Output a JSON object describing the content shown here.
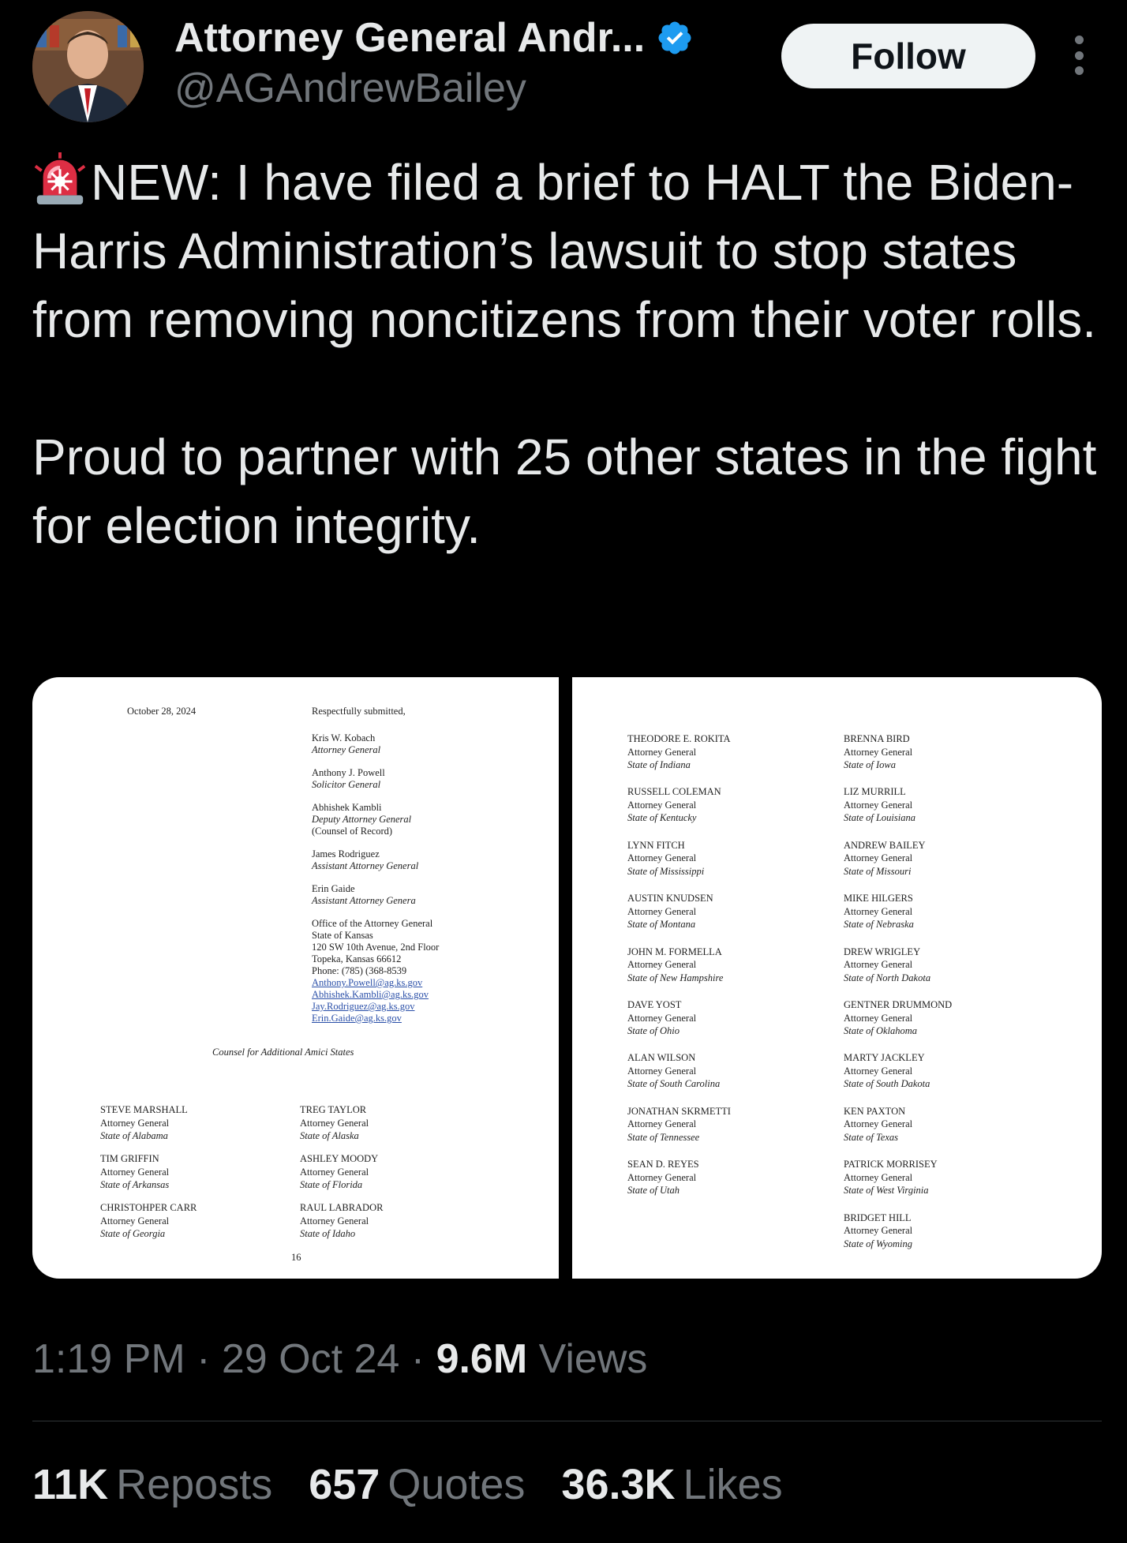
{
  "header": {
    "display_name": "Attorney General Andr...",
    "handle": "@AGAndrewBailey",
    "follow_label": "Follow"
  },
  "tweet": {
    "line1": "NEW: I have filed a brief to HALT the Biden-Harris Administration’s lawsuit to stop states from removing noncitizens from their voter rolls.",
    "line2": "Proud to partner with 25 other states in the fight for election integrity."
  },
  "doc_page1": {
    "date": "October 28, 2024",
    "submitted": "Respectfully submitted,",
    "counsel": [
      {
        "name": "Kris W. Kobach",
        "title": "Attorney General",
        "extra": ""
      },
      {
        "name": "Anthony J. Powell",
        "title": "Solicitor General",
        "extra": ""
      },
      {
        "name": "Abhishek Kambli",
        "title": "Deputy Attorney General",
        "extra": "(Counsel of Record)"
      },
      {
        "name": "James Rodriguez",
        "title": "Assistant Attorney General",
        "extra": ""
      },
      {
        "name": "Erin Gaide",
        "title": "Assistant Attorney Genera",
        "extra": ""
      }
    ],
    "office": [
      "Office of the Attorney General",
      "State of Kansas",
      "120 SW 10th Avenue, 2nd Floor",
      "Topeka, Kansas 66612",
      "Phone: (785) (368-8539"
    ],
    "emails": [
      "Anthony.Powell@ag.ks.gov",
      "Abhishek.Kambli@ag.ks.gov",
      "Jay.Rodriguez@ag.ks.gov",
      "Erin.Gaide@ag.ks.gov"
    ],
    "counsel_for": "Counsel for Additional Amici States",
    "states": [
      {
        "name": "STEVE MARSHALL",
        "role": "Attorney General",
        "state": "State of Alabama"
      },
      {
        "name": "TREG TAYLOR",
        "role": "Attorney General",
        "state": "State of Alaska"
      },
      {
        "name": "TIM GRIFFIN",
        "role": "Attorney General",
        "state": "State of Arkansas"
      },
      {
        "name": "ASHLEY MOODY",
        "role": "Attorney General",
        "state": "State of Florida"
      },
      {
        "name": "CHRISTOHPER CARR",
        "role": "Attorney General",
        "state": "State of Georgia"
      },
      {
        "name": "RAUL LABRADOR",
        "role": "Attorney General",
        "state": "State of Idaho"
      }
    ],
    "page_number": "16"
  },
  "doc_page2": {
    "left": [
      {
        "name": "THEODORE E. ROKITA",
        "role": "Attorney General",
        "state": "State of Indiana"
      },
      {
        "name": "RUSSELL COLEMAN",
        "role": "Attorney General",
        "state": "State of Kentucky"
      },
      {
        "name": "LYNN FITCH",
        "role": "Attorney General",
        "state": "State of Mississippi"
      },
      {
        "name": "AUSTIN KNUDSEN",
        "role": "Attorney General",
        "state": "State of Montana"
      },
      {
        "name": "JOHN M. FORMELLA",
        "role": "Attorney General",
        "state": "State of New Hampshire"
      },
      {
        "name": "DAVE YOST",
        "role": "Attorney General",
        "state": "State of Ohio"
      },
      {
        "name": "ALAN WILSON",
        "role": "Attorney General",
        "state": "State of South Carolina"
      },
      {
        "name": "JONATHAN SKRMETTI",
        "role": "Attorney General",
        "state": "State of Tennessee"
      },
      {
        "name": "SEAN D. REYES",
        "role": "Attorney General",
        "state": "State of Utah"
      }
    ],
    "right": [
      {
        "name": "BRENNA BIRD",
        "role": "Attorney General",
        "state": "State of Iowa"
      },
      {
        "name": "LIZ MURRILL",
        "role": "Attorney General",
        "state": "State of Louisiana"
      },
      {
        "name": "ANDREW BAILEY",
        "role": "Attorney General",
        "state": "State of Missouri"
      },
      {
        "name": "MIKE HILGERS",
        "role": "Attorney General",
        "state": "State of Nebraska"
      },
      {
        "name": "DREW WRIGLEY",
        "role": "Attorney General",
        "state": "State of North Dakota"
      },
      {
        "name": "GENTNER DRUMMOND",
        "role": "Attorney General",
        "state": "State of Oklahoma"
      },
      {
        "name": "MARTY JACKLEY",
        "role": "Attorney General",
        "state": "State of South Dakota"
      },
      {
        "name": "KEN PAXTON",
        "role": "Attorney General",
        "state": "State of Texas"
      },
      {
        "name": "PATRICK MORRISEY",
        "role": "Attorney General",
        "state": "State of West Virginia"
      },
      {
        "name": "BRIDGET HILL",
        "role": "Attorney General",
        "state": "State of Wyoming"
      }
    ]
  },
  "meta": {
    "time": "1:19 PM",
    "date": "29 Oct 24",
    "views_count": "9.6M",
    "views_label": "Views"
  },
  "stats": {
    "reposts_count": "11K",
    "reposts_label": "Reposts",
    "quotes_count": "657",
    "quotes_label": "Quotes",
    "likes_count": "36.3K",
    "likes_label": "Likes"
  },
  "colors": {
    "background": "#000000",
    "text_primary": "#e7e9ea",
    "text_secondary": "#71767b",
    "verified": "#1d9bf0",
    "follow_bg": "#eff3f4"
  }
}
